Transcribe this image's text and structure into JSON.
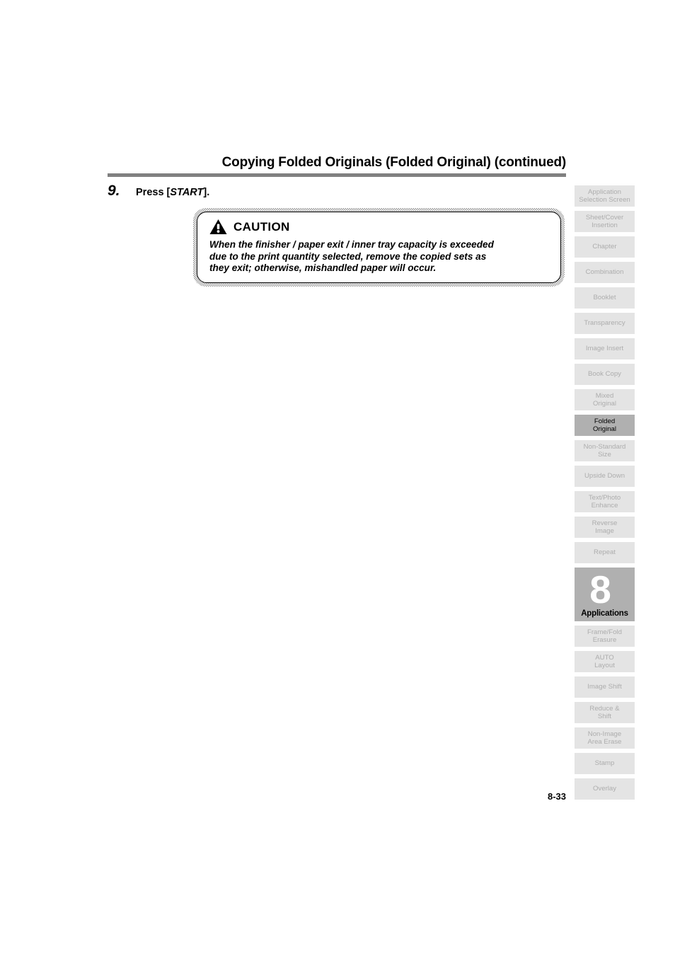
{
  "page": {
    "title": "Copying Folded Originals (Folded Original) (continued)",
    "folio": "8-33"
  },
  "step": {
    "number": "9.",
    "prefix": "Press [",
    "key": "START",
    "suffix": "]."
  },
  "caution": {
    "icon": "warning-triangle-icon",
    "label": "CAUTION",
    "lines": [
      "When the finisher / paper exit / inner tray capacity is exceeded",
      "due to the print quantity selected, remove the copied sets as",
      "they exit; otherwise, mishandled paper will occur."
    ]
  },
  "sidebar": {
    "items": [
      {
        "lines": [
          "Application",
          "Selection Screen"
        ],
        "active": false
      },
      {
        "lines": [
          "Sheet/Cover",
          "Insertion"
        ],
        "active": false
      },
      {
        "lines": [
          "Chapter"
        ],
        "active": false
      },
      {
        "lines": [
          "Combination"
        ],
        "active": false
      },
      {
        "lines": [
          "Booklet"
        ],
        "active": false
      },
      {
        "lines": [
          "Transparency"
        ],
        "active": false
      },
      {
        "lines": [
          "Image Insert"
        ],
        "active": false
      },
      {
        "lines": [
          "Book Copy"
        ],
        "active": false
      },
      {
        "lines": [
          "Mixed",
          "Original"
        ],
        "active": false
      },
      {
        "lines": [
          "Folded",
          "Original"
        ],
        "active": true
      },
      {
        "lines": [
          "Non-Standard",
          "Size"
        ],
        "active": false
      },
      {
        "lines": [
          "Upside Down"
        ],
        "active": false
      },
      {
        "lines": [
          "Text/Photo",
          "Enhance"
        ],
        "active": false
      },
      {
        "lines": [
          "Reverse",
          "Image"
        ],
        "active": false
      },
      {
        "lines": [
          "Repeat"
        ],
        "active": false
      }
    ],
    "chapter": {
      "number": "8",
      "name": "Applications"
    },
    "items_after": [
      {
        "lines": [
          "Frame/Fold",
          "Erasure"
        ],
        "active": false
      },
      {
        "lines": [
          "AUTO",
          "Layout"
        ],
        "active": false
      },
      {
        "lines": [
          "Image Shift"
        ],
        "active": false
      },
      {
        "lines": [
          "Reduce &",
          "Shift"
        ],
        "active": false
      },
      {
        "lines": [
          "Non-Image",
          "Area Erase"
        ],
        "active": false
      },
      {
        "lines": [
          "Stamp"
        ],
        "active": false
      },
      {
        "lines": [
          "Overlay"
        ],
        "active": false
      }
    ]
  },
  "colors": {
    "tab_bg": "#e4e4e4",
    "tab_text": "#adadad",
    "tab_active_bg": "#b0b0b0",
    "rule": "#808080"
  }
}
